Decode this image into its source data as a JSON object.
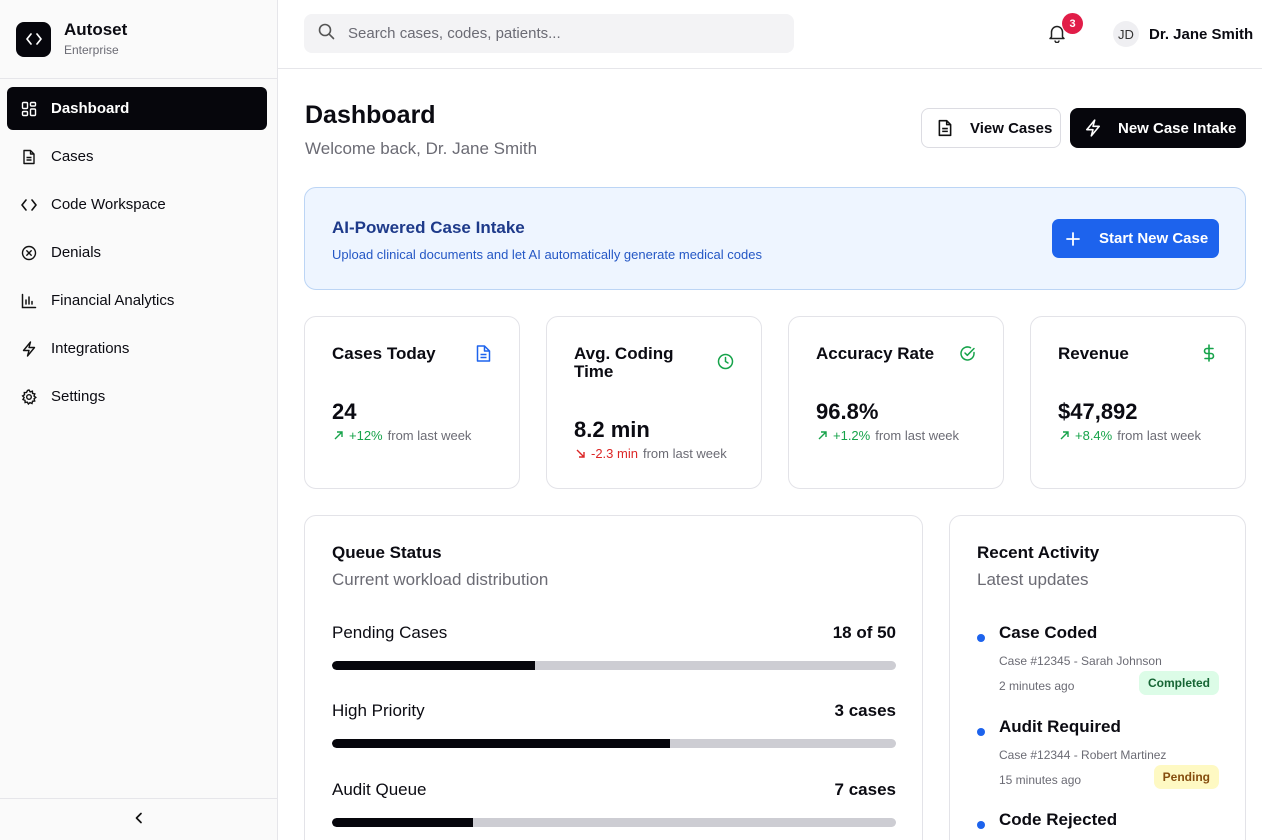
{
  "brand": {
    "name": "Autoset",
    "plan": "Enterprise"
  },
  "sidebar": {
    "items": [
      {
        "label": "Dashboard",
        "icon": "grid-icon",
        "active": true
      },
      {
        "label": "Cases",
        "icon": "document-icon"
      },
      {
        "label": "Code Workspace",
        "icon": "code-icon"
      },
      {
        "label": "Denials",
        "icon": "x-circle-icon"
      },
      {
        "label": "Financial Analytics",
        "icon": "bar-chart-icon"
      },
      {
        "label": "Integrations",
        "icon": "lightning-icon"
      },
      {
        "label": "Settings",
        "icon": "gear-icon"
      }
    ]
  },
  "topbar": {
    "search_placeholder": "Search cases, codes, patients...",
    "notification_count": "3",
    "user_initials": "JD",
    "user_name": "Dr. Jane Smith"
  },
  "header": {
    "title": "Dashboard",
    "subtitle": "Welcome back, Dr. Jane Smith",
    "view_cases_label": "View Cases",
    "new_case_intake_label": "New Case Intake"
  },
  "banner": {
    "title": "AI-Powered Case Intake",
    "subtitle": "Upload clinical documents and let AI automatically generate medical codes",
    "button_label": "Start New Case"
  },
  "stats": [
    {
      "title": "Cases Today",
      "value": "24",
      "delta": "+12%",
      "suffix": "from last week",
      "direction": "up",
      "icon": "document-icon",
      "icon_color": "#1d63ed"
    },
    {
      "title": "Avg. Coding Time",
      "value": "8.2 min",
      "delta": "-2.3 min",
      "suffix": "from last week",
      "direction": "down",
      "icon": "clock-icon",
      "icon_color": "#16a34a"
    },
    {
      "title": "Accuracy Rate",
      "value": "96.8%",
      "delta": "+1.2%",
      "suffix": "from last week",
      "direction": "up",
      "icon": "check-circle-icon",
      "icon_color": "#16a34a"
    },
    {
      "title": "Revenue",
      "value": "$47,892",
      "delta": "+8.4%",
      "suffix": "from last week",
      "direction": "up",
      "icon": "dollar-icon",
      "icon_color": "#16a34a"
    }
  ],
  "queue": {
    "title": "Queue Status",
    "subtitle": "Current workload distribution",
    "rows": [
      {
        "label": "Pending Cases",
        "count": "18 of 50",
        "fraction": 0.36
      },
      {
        "label": "High Priority",
        "count": "3 cases",
        "fraction": 0.6
      },
      {
        "label": "Audit Queue",
        "count": "7 cases",
        "fraction": 0.25
      }
    ]
  },
  "activity": {
    "title": "Recent Activity",
    "subtitle": "Latest updates",
    "items": [
      {
        "title": "Case Coded",
        "meta": "Case #12345 - Sarah Johnson",
        "time": "2 minutes ago",
        "status": "Completed",
        "status_color": "green"
      },
      {
        "title": "Audit Required",
        "meta": "Case #12344 - Robert Martinez",
        "time": "15 minutes ago",
        "status": "Pending",
        "status_color": "yellow"
      },
      {
        "title": "Code Rejected"
      }
    ]
  },
  "colors": {
    "accent": "#1d63ed",
    "dark": "#06060c",
    "success": "#16a34a",
    "danger": "#dc2626",
    "badge": "#e11d48"
  }
}
